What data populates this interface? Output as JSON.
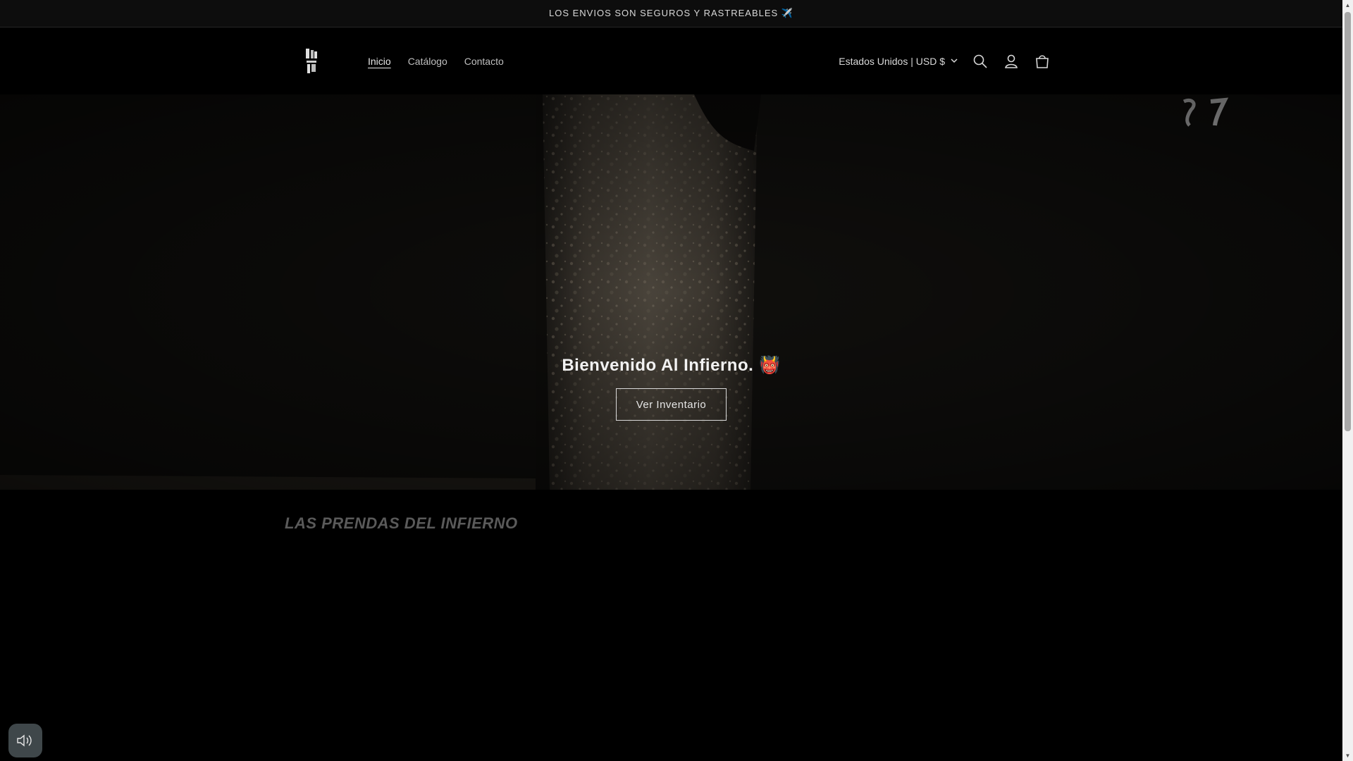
{
  "announcement": {
    "text": "LOS ENVIOS SON SEGUROS Y RASTREABLES ✈️"
  },
  "header": {
    "nav": [
      {
        "label": "Inicio",
        "active": true
      },
      {
        "label": "Catálogo",
        "active": false
      },
      {
        "label": "Contacto",
        "active": false
      }
    ],
    "country_selector": "Estados Unidos | USD $",
    "icons": [
      "search-icon",
      "account-icon",
      "cart-icon"
    ]
  },
  "hero": {
    "title": "Bienvenido Al Infierno.",
    "emoji": "👹",
    "button_label": "Ver Inventario"
  },
  "collection": {
    "title": "LAS PRENDAS DEL INFIERNO"
  },
  "colors": {
    "background": "#000000",
    "hero_overlay": "#0b0a09",
    "muted_heading": "#5a5a5a",
    "sound_button": "#3f474a"
  }
}
